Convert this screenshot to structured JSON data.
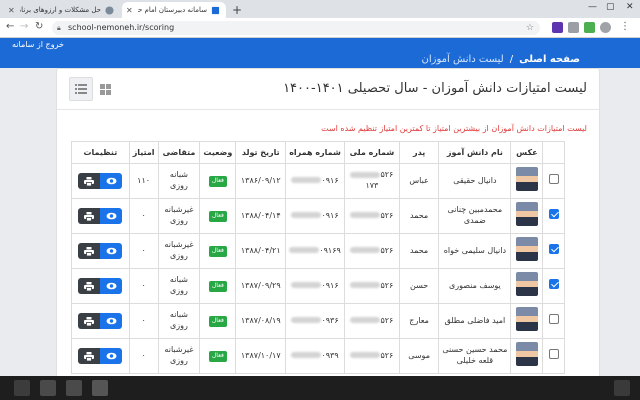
{
  "browser": {
    "tabs": [
      {
        "title": "حل مشکلات و ارزوهای برنامه نو",
        "active": false
      },
      {
        "title": "سامانه دبیرستان امام حسین - لیست",
        "active": true
      }
    ],
    "url": "school-nemoneh.ir/scoring"
  },
  "header": {
    "logout": "خروج از سامانه",
    "breadcrumb_home": "صفحه اصلی",
    "breadcrumb_separator": "/",
    "breadcrumb_current": "لیست دانش آموزان"
  },
  "page": {
    "title": "لیست امتیازات دانش آموزان - سال تحصیلی ۱۴۰۱-۱۴۰۰",
    "note": "لیست امتیازات دانش آموزان از بیشترین امتیاز تا کمترین امتیاز تنظیم شده است"
  },
  "table": {
    "headers": [
      "عکس",
      "نام دانش آموز",
      "پدر",
      "شماره ملی",
      "شماره همراه",
      "تاریخ تولد",
      "وضعیت",
      "متقاضی",
      "امتیاز",
      "تنظیمات"
    ],
    "rows": [
      {
        "checked": false,
        "name": "دانیال حقیقی",
        "father": "عباس",
        "national_prefix": "۵۲۶",
        "national_suffix": "۱۷۳",
        "phone_prefix": "۰۹۱۶",
        "birth": "۱۳۸۶/۰۹/۱۲",
        "status": "فعال",
        "applicant": "شبانه روزی",
        "score": "۱۱۰"
      },
      {
        "checked": true,
        "name": "محمدمبین چنانی ضمدی",
        "father": "محمد",
        "national_prefix": "۵۲۶",
        "national_suffix": "",
        "phone_prefix": "۰۹۱۶",
        "birth": "۱۳۸۸/۰۴/۱۴",
        "status": "فعال",
        "applicant": "غیرشبانه روزی",
        "score": "۰"
      },
      {
        "checked": true,
        "name": "دانیال سلیمی خواه",
        "father": "محمد",
        "national_prefix": "۵۲۶",
        "national_suffix": "",
        "phone_prefix": "۰۹۱۶۹",
        "birth": "۱۳۸۸/۰۴/۲۱",
        "status": "فعال",
        "applicant": "غیرشبانه روزی",
        "score": "۰"
      },
      {
        "checked": true,
        "name": "یوسف منصوری",
        "father": "حسن",
        "national_prefix": "۵۲۶",
        "national_suffix": "",
        "phone_prefix": "۰۹۱۶",
        "birth": "۱۳۸۷/۰۹/۲۹",
        "status": "فعال",
        "applicant": "شبانه روزی",
        "score": "۰"
      },
      {
        "checked": false,
        "name": "امید فاضلی مطلق",
        "father": "معارج",
        "national_prefix": "۵۲۶",
        "national_suffix": "",
        "phone_prefix": "۰۹۳۶",
        "birth": "۱۳۸۷/۰۸/۱۹",
        "status": "فعال",
        "applicant": "شبانه روزی",
        "score": "۰"
      },
      {
        "checked": false,
        "name": "محمد حسین حسنی قلعه خلیلی",
        "father": "موسی",
        "national_prefix": "۵۲۶",
        "national_suffix": "",
        "phone_prefix": "۰۹۳۹",
        "birth": "۱۳۸۷/۱۰/۱۷",
        "status": "فعال",
        "applicant": "غیرشبانه روزی",
        "score": "۰"
      }
    ]
  },
  "colors": {
    "header_blue": "#1b6ad6",
    "view_button": "#1a73e8",
    "print_button": "#3a3f45",
    "status_green": "#28a745",
    "note_red": "#e03a3a"
  },
  "icons": {
    "view": "eye-icon",
    "print": "printer-icon",
    "grid_view": "grid-icon",
    "list_view": "list-icon"
  }
}
